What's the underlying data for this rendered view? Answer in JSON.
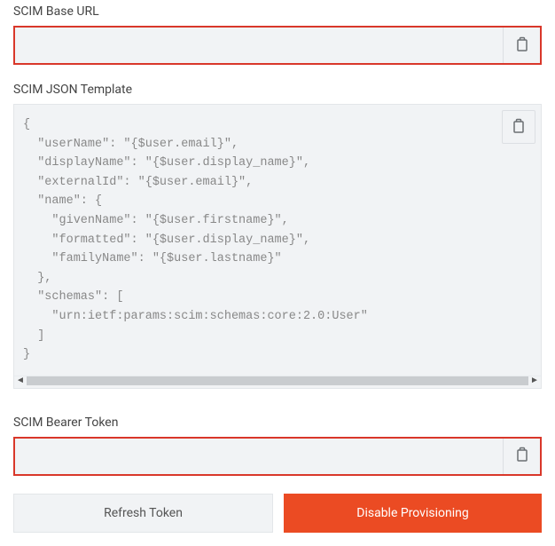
{
  "fields": {
    "base_url": {
      "label": "SCIM Base URL",
      "value": ""
    },
    "json_template": {
      "label": "SCIM JSON Template",
      "value": "{\n  \"userName\": \"{$user.email}\",\n  \"displayName\": \"{$user.display_name}\",\n  \"externalId\": \"{$user.email}\",\n  \"name\": {\n    \"givenName\": \"{$user.firstname}\",\n    \"formatted\": \"{$user.display_name}\",\n    \"familyName\": \"{$user.lastname}\"\n  },\n  \"schemas\": [\n    \"urn:ietf:params:scim:schemas:core:2.0:User\"\n  ]\n}"
    },
    "bearer_token": {
      "label": "SCIM Bearer Token",
      "value": ""
    }
  },
  "buttons": {
    "refresh": "Refresh Token",
    "disable": "Disable Provisioning"
  }
}
